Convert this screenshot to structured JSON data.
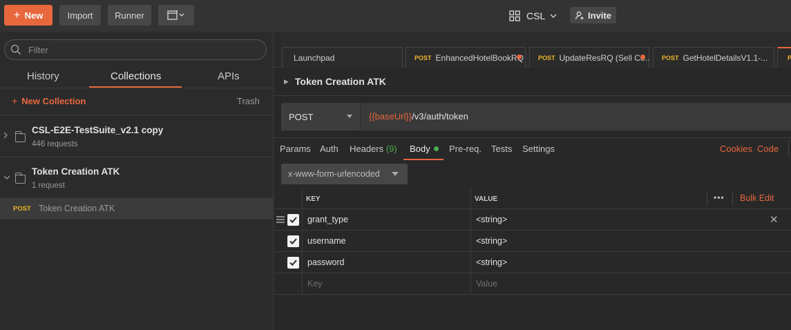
{
  "topbar": {
    "new_label": "New",
    "import_label": "Import",
    "runner_label": "Runner",
    "workspace_name": "CSL",
    "invite_label": "Invite"
  },
  "sidebar": {
    "filter_placeholder": "Filter",
    "tabs": [
      "History",
      "Collections",
      "APIs"
    ],
    "active_tab": "Collections",
    "new_collection_label": "New Collection",
    "trash_label": "Trash",
    "collections": [
      {
        "name": "CSL-E2E-TestSuite_v2.1 copy",
        "sub": "446 requests",
        "expanded": false
      },
      {
        "name": "Token Creation ATK",
        "sub": "1 request",
        "expanded": true
      }
    ],
    "requests": [
      {
        "method": "POST",
        "name": "Token Creation ATK"
      }
    ]
  },
  "request_tabs": [
    {
      "method": "",
      "label": "Launchpad",
      "modified": false
    },
    {
      "method": "POST",
      "label": "EnhancedHotelBookRQ",
      "modified": true
    },
    {
      "method": "POST",
      "label": "UpdateResRQ (Sell Co...",
      "modified": true
    },
    {
      "method": "POST",
      "label": "GetHotelDetailsV1.1-...",
      "modified": false
    },
    {
      "method": "P",
      "label": "",
      "modified": false
    }
  ],
  "request": {
    "title": "Token Creation ATK",
    "method": "POST",
    "url_var": "{{baseUrl}}",
    "url_path": "/v3/auth/token"
  },
  "subtabs": {
    "params": "Params",
    "auth": "Auth",
    "headers": "Headers",
    "headers_count": "(9)",
    "body": "Body",
    "prereq": "Pre-req.",
    "tests": "Tests",
    "settings": "Settings",
    "cookies": "Cookies",
    "code": "Code"
  },
  "body": {
    "mode": "x-www-form-urlencoded",
    "header_key": "KEY",
    "header_value": "VALUE",
    "more": "•••",
    "bulk_edit": "Bulk Edit",
    "rows": [
      {
        "key": "grant_type",
        "value": "<string>",
        "checked": true
      },
      {
        "key": "username",
        "value": "<string>",
        "checked": true
      },
      {
        "key": "password",
        "value": "<string>",
        "checked": true
      }
    ],
    "key_placeholder": "Key",
    "value_placeholder": "Value"
  },
  "colors": {
    "accent": "#e8673d",
    "post": "#f0b429",
    "status_green": "#4caf50"
  }
}
